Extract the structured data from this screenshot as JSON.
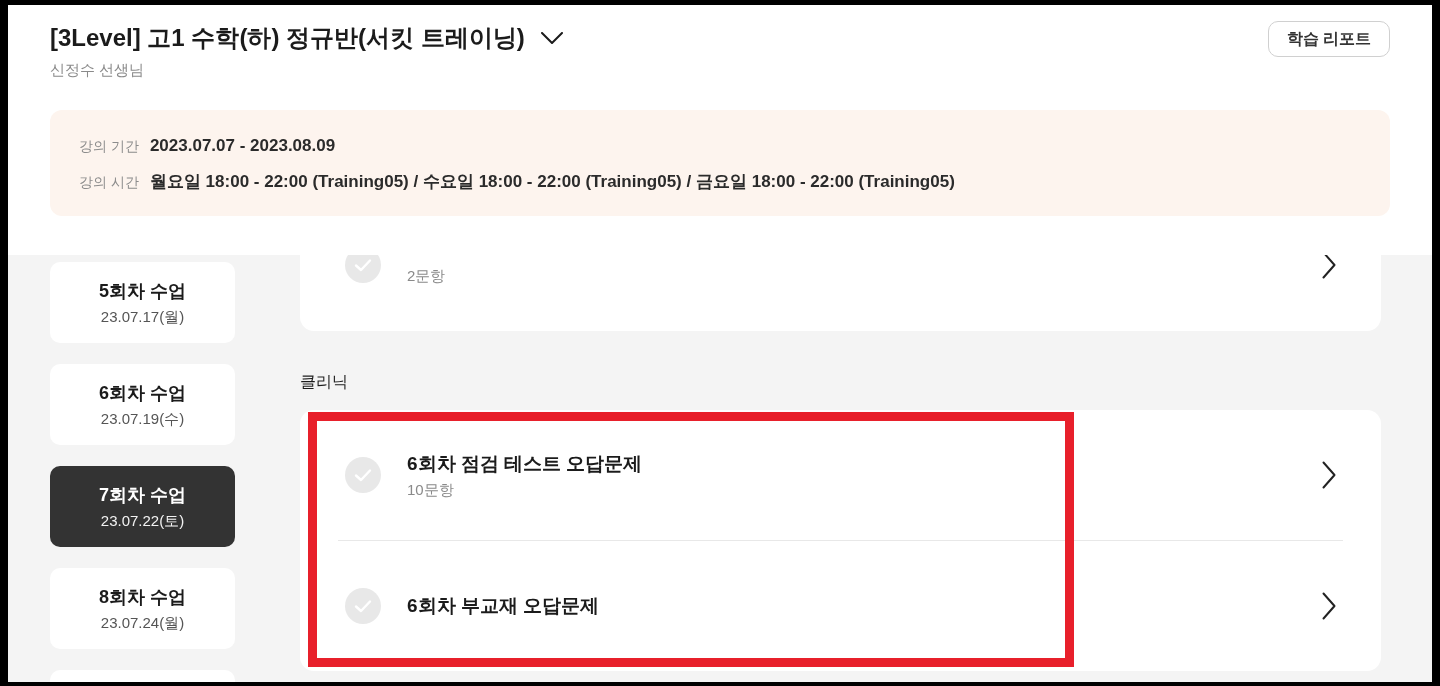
{
  "header": {
    "title": "[3Level] 고1 수학(하) 정규반(서킷 트레이닝)",
    "teacher": "신정수 선생님",
    "report_button": "학습 리포트"
  },
  "course_info": [
    {
      "label": "강의 기간",
      "value": "2023.07.07 - 2023.08.09"
    },
    {
      "label": "강의 시간",
      "value": "월요일 18:00 - 22:00 (Training05) / 수요일 18:00 - 22:00 (Training05) / 금요일 18:00 - 22:00 (Training05)"
    }
  ],
  "sessions": [
    {
      "title": "5회차 수업",
      "date": "23.07.17(월)",
      "selected": false
    },
    {
      "title": "6회차 수업",
      "date": "23.07.19(수)",
      "selected": false
    },
    {
      "title": "7회차 수업",
      "date": "23.07.22(토)",
      "selected": true
    },
    {
      "title": "8회차 수업",
      "date": "23.07.24(월)",
      "selected": false
    },
    {
      "selected": false
    }
  ],
  "sections": [
    {
      "highlighted": false,
      "items": [
        {
          "count": "2문항",
          "done": false
        }
      ]
    },
    {
      "heading": "클리닉",
      "highlighted": true,
      "items": [
        {
          "title": "6회차 점검 테스트 오답문제",
          "count": "10문항",
          "done": false
        },
        {
          "title": "6회차 부교재 오답문제",
          "done": false
        }
      ]
    }
  ]
}
